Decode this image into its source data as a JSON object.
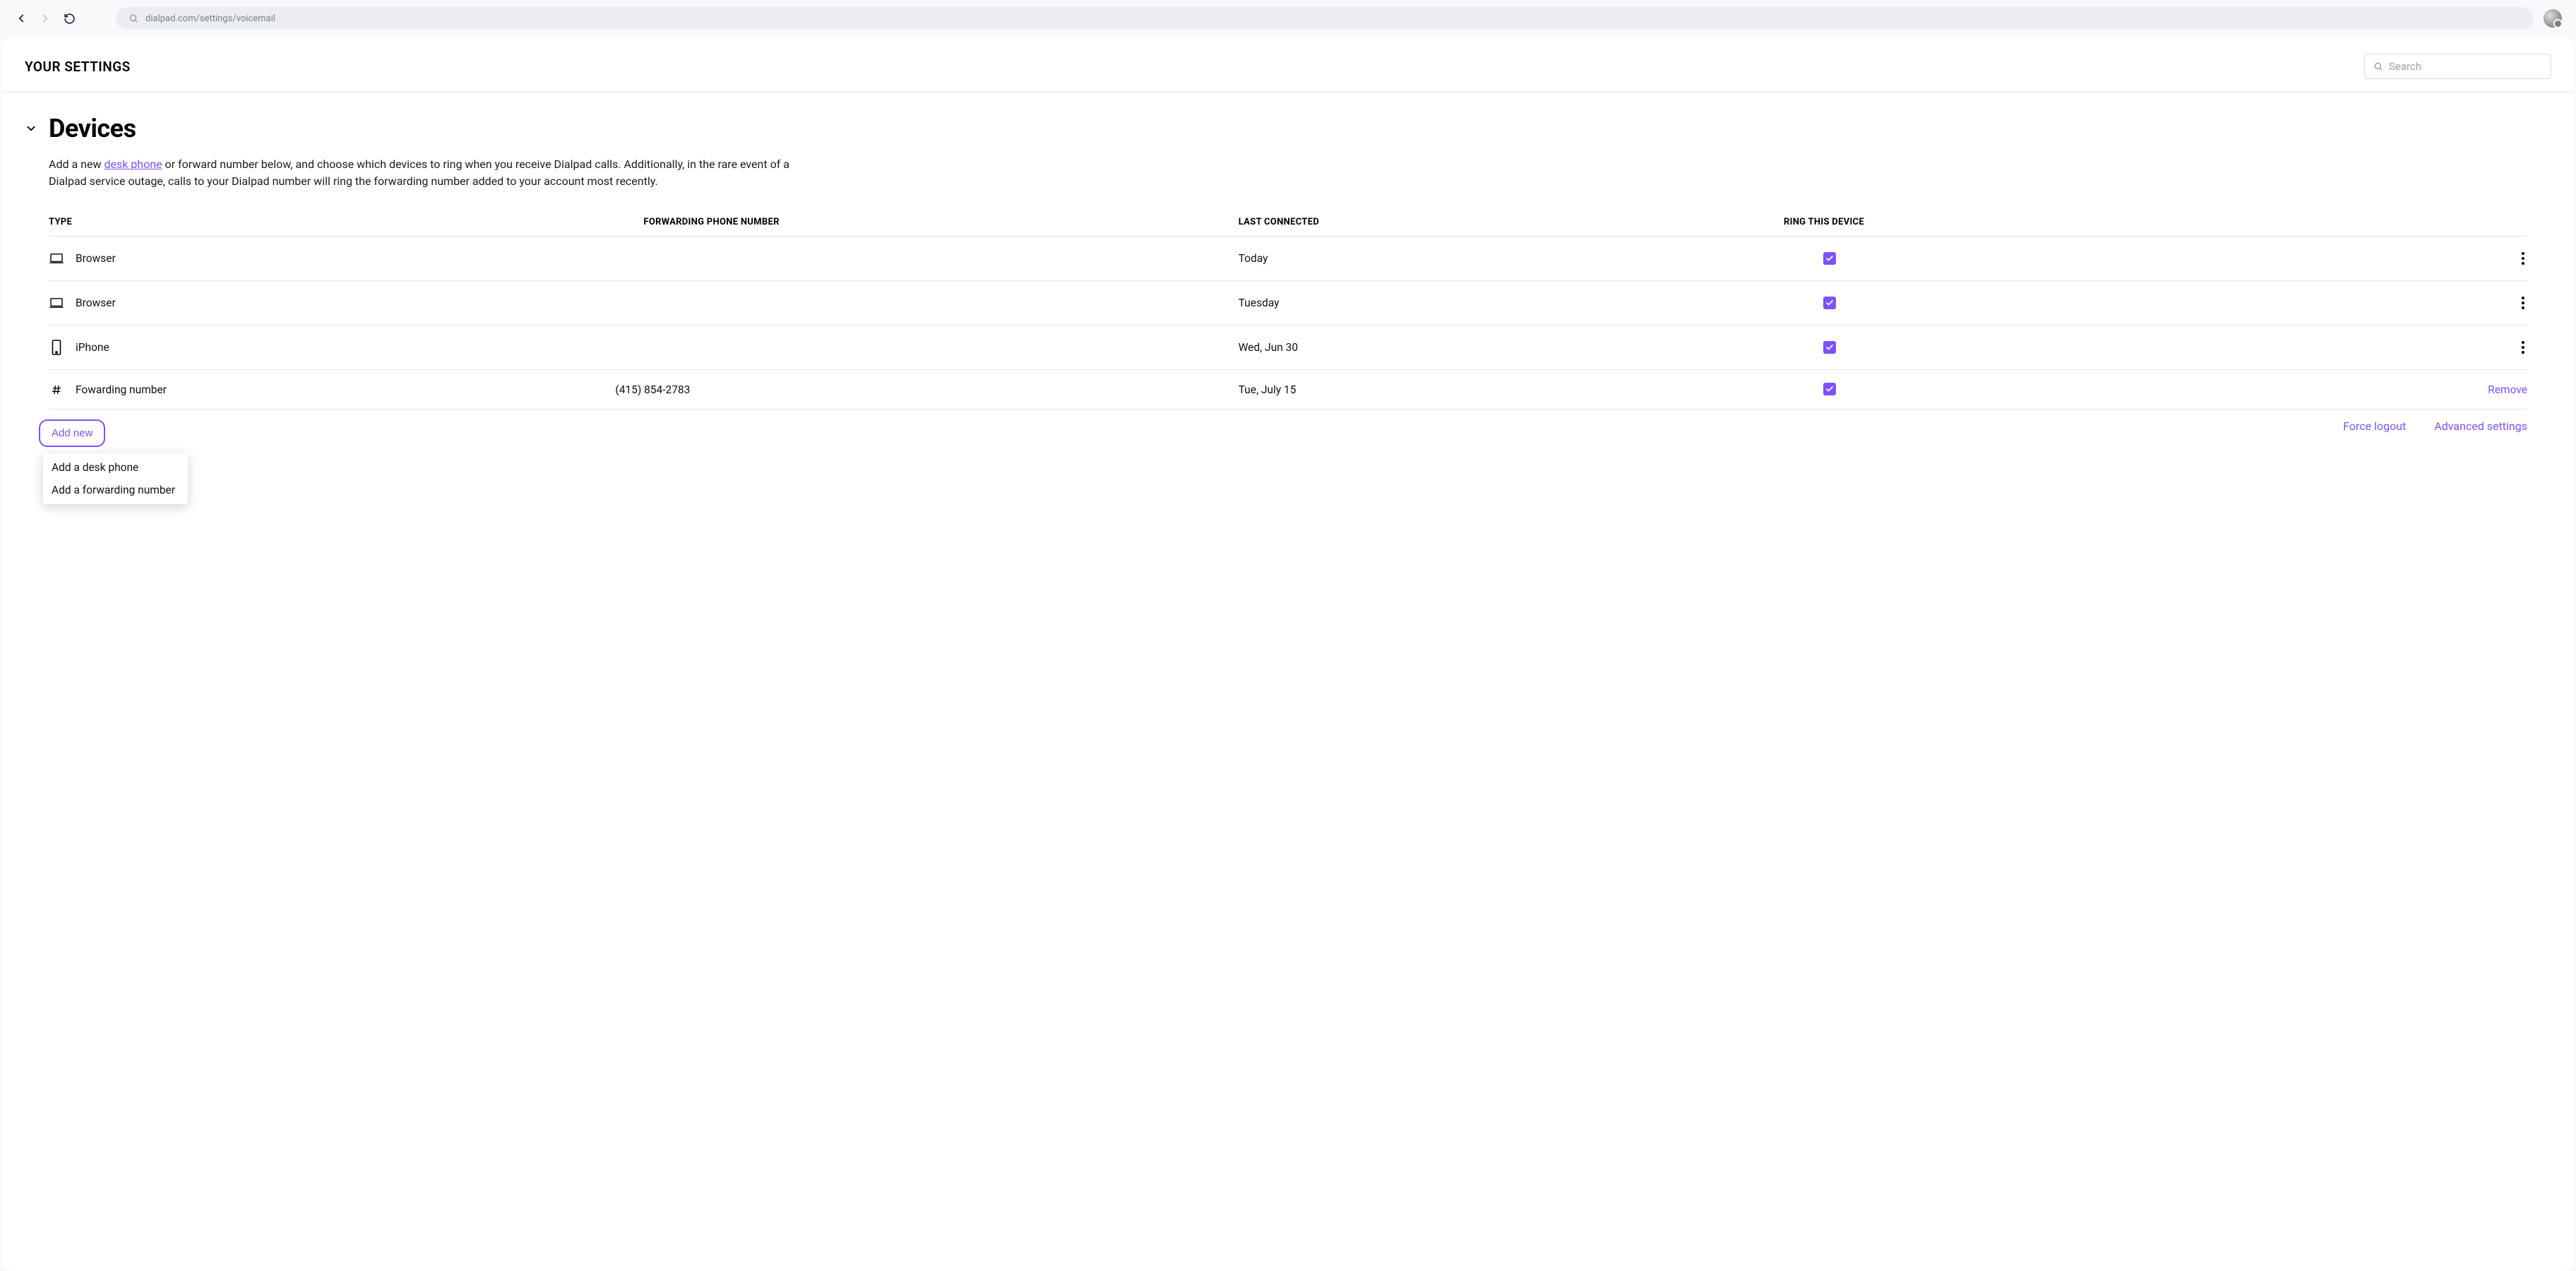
{
  "browser": {
    "url": "dialpad.com/settings/voicemail"
  },
  "header": {
    "title": "YOUR SETTINGS",
    "search_placeholder": "Search"
  },
  "section": {
    "title": "Devices",
    "desc_before_link": "Add a new ",
    "desc_link": "desk phone",
    "desc_after_link": " or forward number below, and choose which devices to ring when you receive Dialpad calls. Additionally, in the rare event of a Dialpad service outage, calls to your Dialpad number will ring the forwarding number added to your account most recently."
  },
  "table": {
    "columns": {
      "type": "TYPE",
      "fwd": "FORWARDING PHONE NUMBER",
      "last": "LAST CONNECTED",
      "ring": "RING THIS DEVICE"
    },
    "rows": [
      {
        "icon": "laptop",
        "type": "Browser",
        "fwd": "",
        "last": "Today",
        "ring": true,
        "action": "kebab"
      },
      {
        "icon": "laptop",
        "type": "Browser",
        "fwd": "",
        "last": "Tuesday",
        "ring": true,
        "action": "kebab"
      },
      {
        "icon": "phone",
        "type": "iPhone",
        "fwd": "",
        "last": "Wed, Jun 30",
        "ring": true,
        "action": "kebab"
      },
      {
        "icon": "hash",
        "type": "Fowarding number",
        "fwd": "(415) 854-2783",
        "last": "Tue, July 15",
        "ring": true,
        "action": "remove"
      }
    ]
  },
  "footer": {
    "add_new": "Add new",
    "dropdown": {
      "opt1": "Add a desk phone",
      "opt2": "Add a forwarding number"
    },
    "force_logout": "Force logout",
    "advanced": "Advanced settings",
    "remove_label": "Remove"
  }
}
